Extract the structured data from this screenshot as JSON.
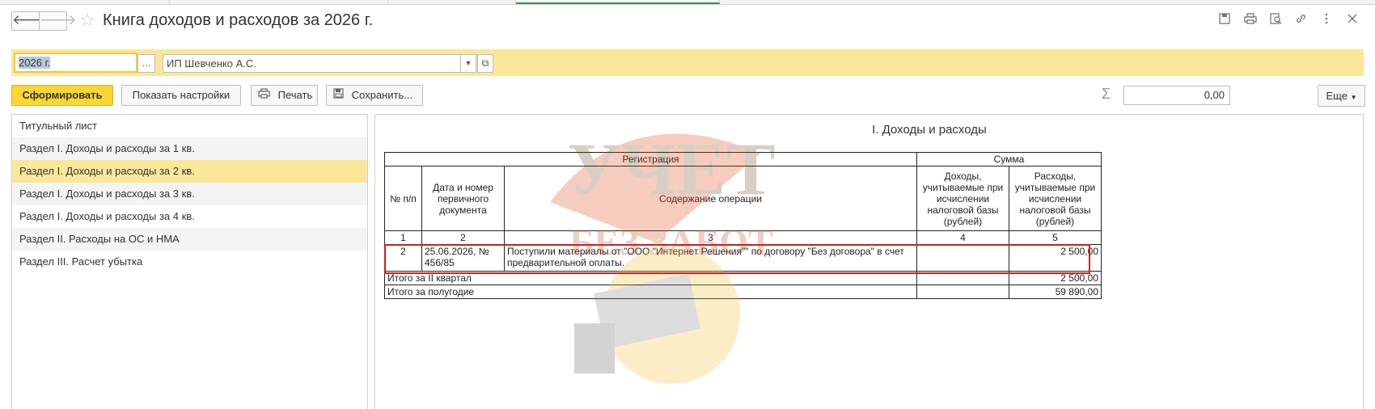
{
  "window": {
    "title": "Книга доходов и расходов за 2026 г.",
    "back_glyph": "🡐",
    "forward_glyph": "🡒",
    "favorite_glyph": "☆",
    "toolbar_icons": [
      "save-icon",
      "print-icon",
      "preview-icon",
      "link-icon",
      "more-vertical-icon",
      "expand-icon"
    ]
  },
  "filters": {
    "period_value": "2026 г.",
    "period_select": "...",
    "organization_value": "ИП Шевченко А.С."
  },
  "toolbar": {
    "generate_label": "Сформировать",
    "settings_label": "Показать настройки",
    "print_label": "Печать",
    "save_label": "Сохранить...",
    "sigma_glyph": "Σ",
    "sum_value": "0,00",
    "more_label": "Еще"
  },
  "sections": [
    {
      "label": "Титульный лист"
    },
    {
      "label": "Раздел I. Доходы и расходы за 1 кв."
    },
    {
      "label": "Раздел I. Доходы и расходы за 2 кв."
    },
    {
      "label": "Раздел I. Доходы и расходы за 3 кв."
    },
    {
      "label": "Раздел I. Доходы и расходы за 4 кв."
    },
    {
      "label": "Раздел II. Расходы на ОС и НМА"
    },
    {
      "label": "Раздел III. Расчет убытка"
    }
  ],
  "selected_section": 2,
  "report": {
    "title": "I. Доходы и расходы",
    "header": {
      "registration": "Регистрация",
      "sum": "Сумма",
      "num": "№ п/п",
      "doc": "Дата и номер первичного документа",
      "content": "Содержание операции",
      "income": "Доходы, учитываемые при исчислении налоговой базы (рублей)",
      "expense": "Расходы, учитываемые при исчислении налоговой базы (рублей)"
    },
    "col_numbers": [
      "1",
      "2",
      "3",
      "4",
      "5"
    ],
    "rows": [
      {
        "num": "2",
        "doc": "25.06.2026, № 456/85",
        "content": "Поступили материалы от \"ООО \"Интернет Решения\"\" по договору \"Без договора\" в счет предварительной оплаты.",
        "income": "",
        "expense": "2 500,00"
      }
    ],
    "totals": [
      {
        "label": "Итого за II квартал",
        "income": "",
        "expense": "2 500,00"
      },
      {
        "label": "Итого за полугодие",
        "income": "",
        "expense": "59 890,00"
      }
    ]
  },
  "watermark": {
    "line1": "УЧЕТ",
    "line2": "БЕЗ ЗАБОТ"
  }
}
